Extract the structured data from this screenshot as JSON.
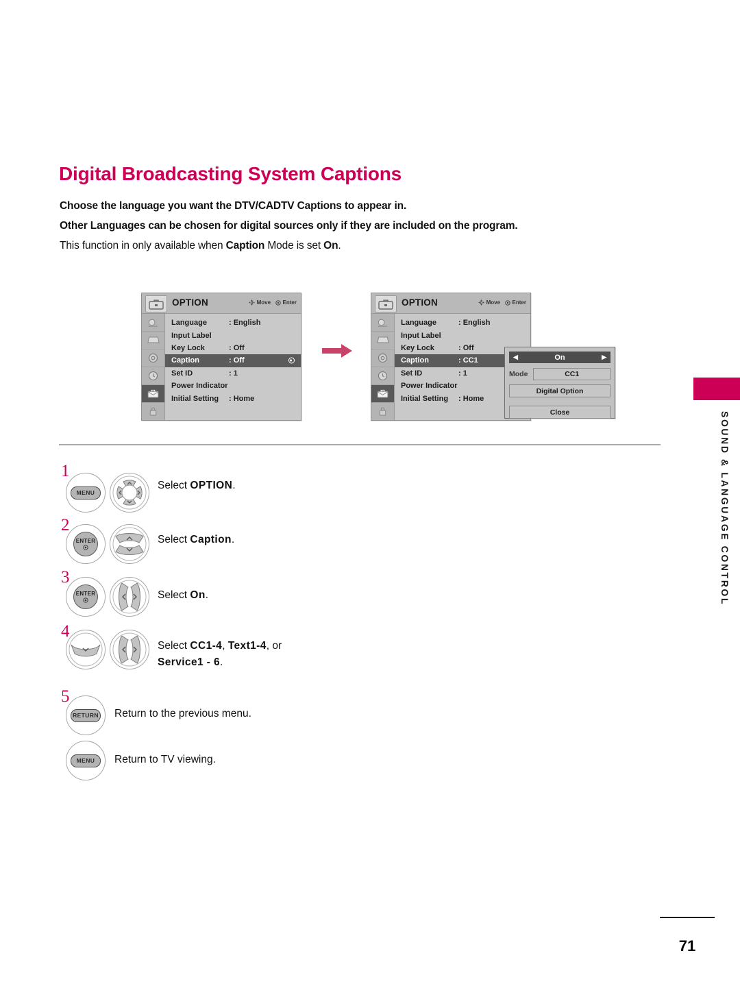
{
  "document": {
    "title": "Digital Broadcasting System Captions",
    "title_color": "#CC0055",
    "page_number": "71",
    "side_tab": "SOUND & LANGUAGE CONTROL"
  },
  "intro": {
    "line1": "Choose the language you want the DTV/CADTV Captions to appear in.",
    "line2": "Other Languages can be chosen for digital sources only if they are included on the program.",
    "line3_a": "This function in only available when ",
    "line3_b": "Caption",
    "line3_c": " Mode is set ",
    "line3_d": "On",
    "line3_e": "."
  },
  "osd_before": {
    "menu_title": "OPTION",
    "hint_move": "Move",
    "hint_enter": "Enter",
    "rows": [
      {
        "label": "Language",
        "value": ": English",
        "highlight": false,
        "radio": false
      },
      {
        "label": "Input Label",
        "value": "",
        "highlight": false,
        "radio": false
      },
      {
        "label": "Key Lock",
        "value": ": Off",
        "highlight": false,
        "radio": false
      },
      {
        "label": "Caption",
        "value": ": Off",
        "highlight": true,
        "radio": true
      },
      {
        "label": "Set ID",
        "value": ": 1",
        "highlight": false,
        "radio": false
      },
      {
        "label": "Power Indicator",
        "value": "",
        "highlight": false,
        "radio": false
      },
      {
        "label": "Initial Setting",
        "value": ": Home",
        "highlight": false,
        "radio": false
      }
    ],
    "rail_icons": [
      "picture-icon",
      "screen-icon",
      "audio-icon",
      "time-icon",
      "option-icon",
      "lock-icon"
    ],
    "rail_selected_index": 4
  },
  "osd_after": {
    "menu_title": "OPTION",
    "hint_move": "Move",
    "hint_enter": "Enter",
    "rows": [
      {
        "label": "Language",
        "value": ": English",
        "highlight": false,
        "radio": false
      },
      {
        "label": "Input Label",
        "value": "",
        "highlight": false,
        "radio": false
      },
      {
        "label": "Key Lock",
        "value": ": Off",
        "highlight": false,
        "radio": false
      },
      {
        "label": "Caption",
        "value": ": CC1",
        "highlight": true,
        "radio": false
      },
      {
        "label": "Set ID",
        "value": ": 1",
        "highlight": false,
        "radio": false
      },
      {
        "label": "Power Indicator",
        "value": "",
        "highlight": false,
        "radio": false
      },
      {
        "label": "Initial Setting",
        "value": ": Home",
        "highlight": false,
        "radio": false
      }
    ],
    "rail_icons": [
      "picture-icon",
      "screen-icon",
      "audio-icon",
      "time-icon",
      "option-icon",
      "lock-icon"
    ],
    "rail_selected_index": 4
  },
  "popup": {
    "state_value": "On",
    "mode_label": "Mode",
    "mode_value": "CC1",
    "digital_option": "Digital Option",
    "close": "Close"
  },
  "steps": [
    {
      "number": "1",
      "buttons": [
        "MENU",
        "dpad-4way"
      ],
      "text_plain": "Select ",
      "text_bold": "OPTION",
      "text_tail": "."
    },
    {
      "number": "2",
      "buttons": [
        "ENTER",
        "updown-rocker"
      ],
      "text_plain": "Select ",
      "text_bold": "Caption",
      "text_tail": "."
    },
    {
      "number": "3",
      "buttons": [
        "ENTER",
        "leftright-rocker"
      ],
      "text_plain": "Select ",
      "text_bold": "On",
      "text_tail": "."
    },
    {
      "number": "4",
      "buttons": [
        "down-rocker",
        "leftright-rocker"
      ],
      "text_line1_plain": "Select ",
      "text_line1_b1": "CC1-4",
      "text_line1_mid": ", ",
      "text_line1_b2": "Text1-4",
      "text_line1_tail": ", or",
      "text_line2_bold": "Service1 - 6",
      "text_line2_tail": "."
    },
    {
      "number": "5",
      "buttons": [
        "RETURN"
      ],
      "text_plain": "Return to the previous menu."
    }
  ],
  "final_step": {
    "button": "MENU",
    "text": "Return to TV viewing."
  },
  "colors": {
    "accent": "#CC0055",
    "osd_bg": "#C9C9C9",
    "osd_highlight": "#5B5B5B"
  }
}
